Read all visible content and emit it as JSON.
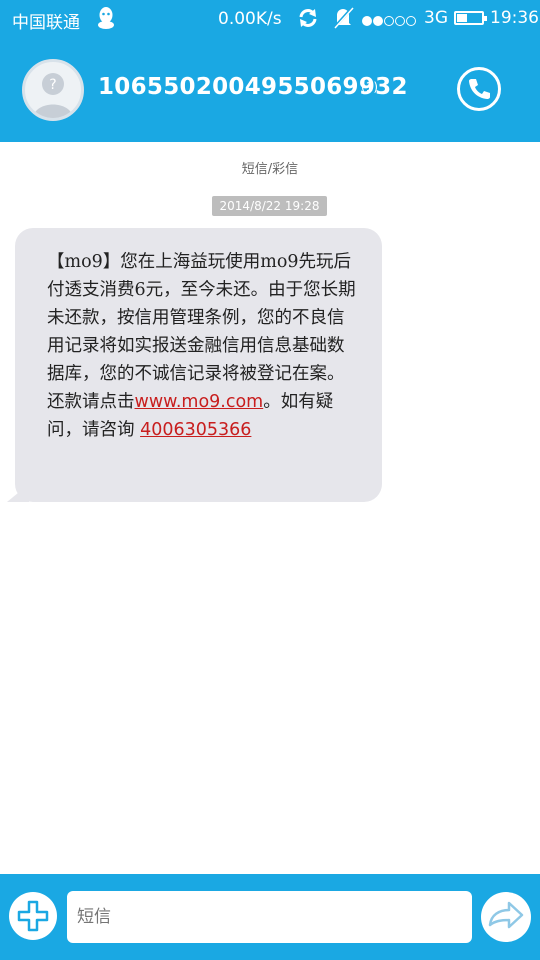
{
  "status_bar": {
    "carrier": "中国联通",
    "net_speed": "0.00K/s",
    "network_type": "3G",
    "time": "19:36",
    "signal_strength": 2,
    "signal_max": 5,
    "battery_level": 0.4,
    "icons": [
      "qq-icon",
      "sync-icon",
      "mute-icon",
      "signal-icon",
      "battery-icon"
    ]
  },
  "header": {
    "contact_number": "1065502004955069932",
    "message_count": "(1)",
    "icons": [
      "avatar-icon",
      "phone-icon"
    ]
  },
  "conversation": {
    "type_label": "短信/彩信",
    "timestamp": "2014/8/22 19:28",
    "message": {
      "text_main": "【mo9】您在上海益玩使用mo9先玩后付透支消费6元，至今未还。由于您长期未还款，按信用管理条例，您的不良信用记录将如实报送金融信用信息基础数据库，您的不诚信记录将被登记在案。还款请点击",
      "link_url": "www.mo9.com",
      "text_after_link": "。如有疑问，请咨询 ",
      "link_phone": "4006305366"
    }
  },
  "composer": {
    "placeholder": "短信",
    "icons": [
      "add-icon",
      "send-icon"
    ]
  },
  "colors": {
    "accent": "#1aa8e3",
    "bubble": "#e6e6eb",
    "link": "#c81e1e"
  }
}
